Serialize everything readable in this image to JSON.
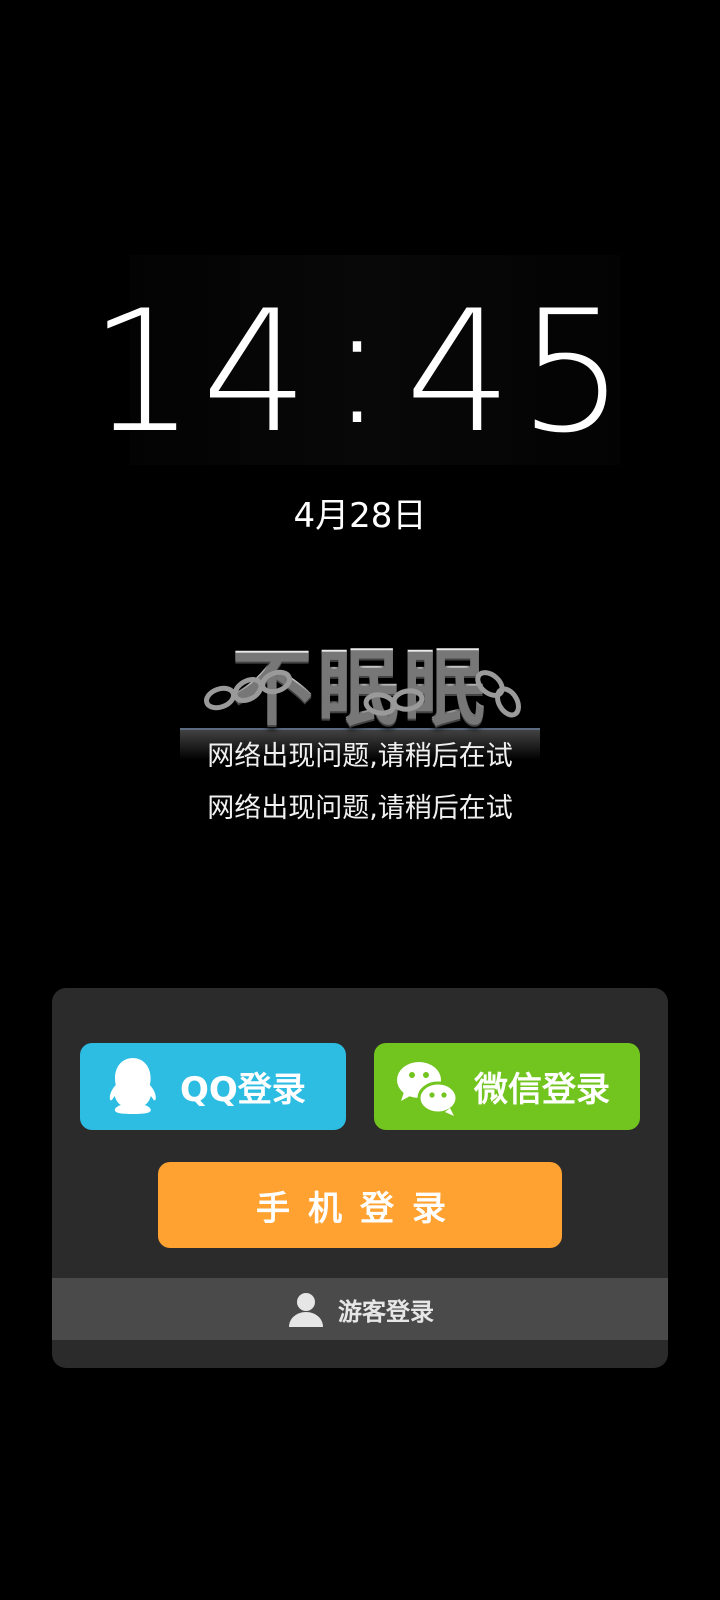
{
  "lockscreen": {
    "hour": "14",
    "separator": ":",
    "minute": "45",
    "date": "4月28日"
  },
  "game": {
    "logo_text": "不眠眠",
    "error_line_1": "网络出现问题,请稍后在试",
    "error_line_2": "网络出现问题,请稍后在试"
  },
  "login": {
    "qq_label": "QQ登录",
    "wechat_label": "微信登录",
    "phone_label": "手机登录",
    "guest_label": "游客登录",
    "colors": {
      "qq": "#2ebde2",
      "wechat": "#72c41e",
      "phone": "#ffa231",
      "panel": "#2b2b2b",
      "guest_bar": "#4a4a4a"
    },
    "icons": {
      "qq": "qq-penguin-icon",
      "wechat": "wechat-icon",
      "guest": "user-icon"
    }
  }
}
